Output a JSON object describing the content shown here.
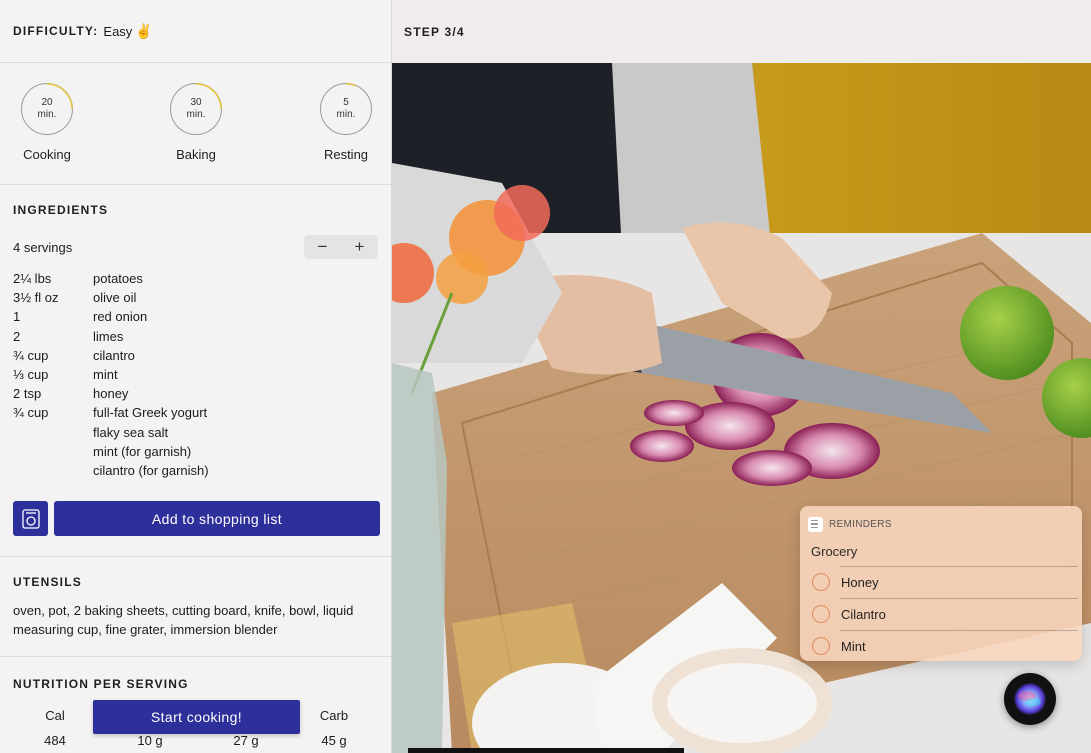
{
  "difficulty": {
    "label": "DIFFICULTY:",
    "value": "Easy",
    "emoji": "✌"
  },
  "timers": [
    {
      "value": "20",
      "unit": "min.",
      "label": "Cooking"
    },
    {
      "value": "30",
      "unit": "min.",
      "label": "Baking"
    },
    {
      "value": "5",
      "unit": "min.",
      "label": "Resting"
    }
  ],
  "ingredients": {
    "title": "INGREDIENTS",
    "servings": "4 servings",
    "minus": "−",
    "plus": "+",
    "items": [
      {
        "qty": "2¼ lbs",
        "name": "potatoes"
      },
      {
        "qty": "3½ fl oz",
        "name": "olive oil"
      },
      {
        "qty": "1",
        "name": "red onion"
      },
      {
        "qty": "2",
        "name": "limes"
      },
      {
        "qty": "¾ cup",
        "name": "cilantro"
      },
      {
        "qty": "⅓ cup",
        "name": "mint"
      },
      {
        "qty": "2 tsp",
        "name": "honey"
      },
      {
        "qty": "¾ cup",
        "name": "full-fat Greek yogurt"
      },
      {
        "qty": "",
        "name": "flaky sea salt"
      },
      {
        "qty": "",
        "name": "mint (for garnish)"
      },
      {
        "qty": "",
        "name": "cilantro (for garnish)"
      }
    ],
    "shopping_button": "Add to shopping list"
  },
  "utensils": {
    "title": "UTENSILS",
    "text": "oven, pot, 2 baking sheets, cutting board, knife, bowl, liquid measuring cup, fine grater, immersion blender"
  },
  "nutrition": {
    "title": "NUTRITION PER SERVING",
    "columns": [
      {
        "label": "Cal",
        "value": "484"
      },
      {
        "label": "",
        "value": "10 g"
      },
      {
        "label": "",
        "value": "27 g"
      },
      {
        "label": "Carb",
        "value": "45 g"
      }
    ]
  },
  "start_button": "Start cooking!",
  "step": {
    "label": "STEP 3/4"
  },
  "reminders": {
    "app": "REMINDERS",
    "list": "Grocery",
    "items": [
      "Honey",
      "Cilantro",
      "Mint"
    ]
  },
  "colors": {
    "accent": "#2d2f9a",
    "timer_progress": "#e8c840",
    "reminder_circle": "#e08a5a"
  }
}
